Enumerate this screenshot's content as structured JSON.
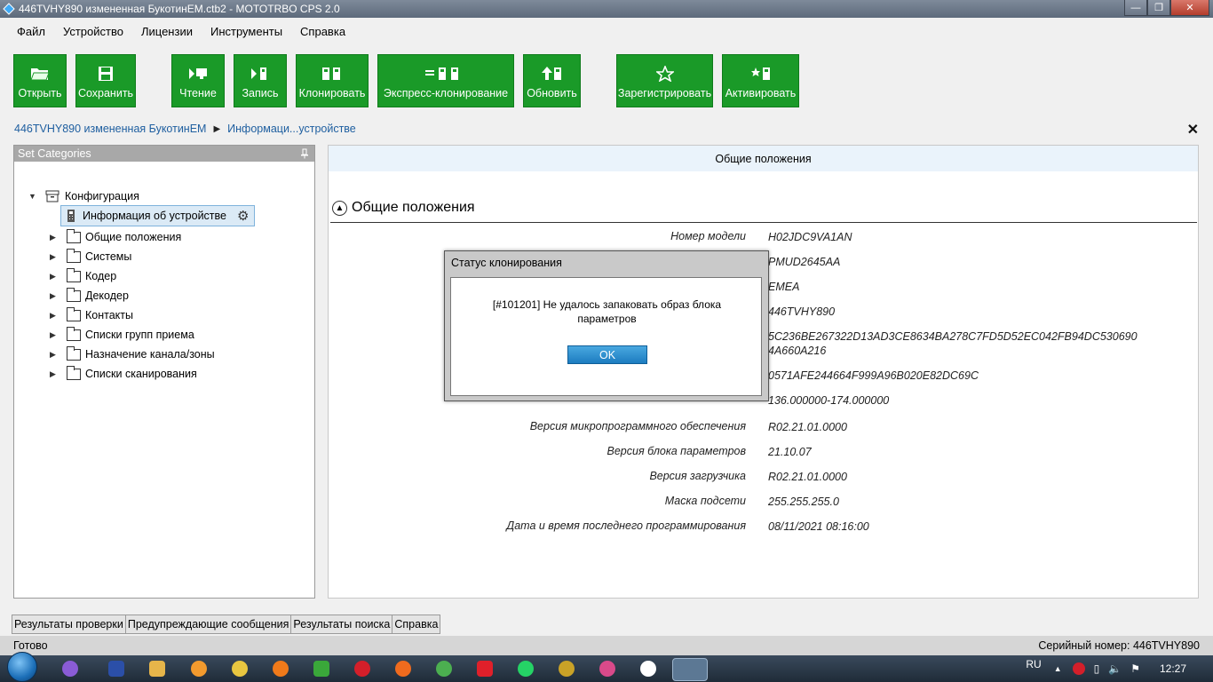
{
  "window": {
    "title": "446TVHY890 измененная БукотинЕМ.ctb2 - MOTOTRBO CPS 2.0",
    "controls": [
      "minimize",
      "maximize",
      "close"
    ]
  },
  "menu": [
    "Файл",
    "Устройство",
    "Лицензии",
    "Инструменты",
    "Справка"
  ],
  "toolbar": {
    "color": "#1a9a28",
    "buttons": [
      {
        "label": "Открыть",
        "icon": "folder-open-icon"
      },
      {
        "label": "Сохранить",
        "icon": "save-icon"
      },
      {
        "label": "Чтение",
        "icon": "read-icon"
      },
      {
        "label": "Запись",
        "icon": "write-icon"
      },
      {
        "label": "Клонировать",
        "icon": "clone-icon"
      },
      {
        "label": "Экспресс-клонирование",
        "icon": "express-clone-icon"
      },
      {
        "label": "Обновить",
        "icon": "update-icon"
      },
      {
        "label": "Зарегистрировать",
        "icon": "star-icon"
      },
      {
        "label": "Активировать",
        "icon": "activate-icon"
      }
    ]
  },
  "breadcrumb": {
    "root": "446TVHY890 измененная БукотинЕМ",
    "current": "Информаци...устройстве"
  },
  "left_panel": {
    "title": "Set Categories",
    "root": "Конфигурация",
    "selected": "Информация об устройстве",
    "items": [
      "Общие положения",
      "Системы",
      "Кодер",
      "Декодер",
      "Контакты",
      "Списки групп приема",
      "Назначение канала/зоны",
      "Списки сканирования"
    ]
  },
  "right_panel": {
    "header": "Общие положения",
    "section": "Общие положения",
    "properties": [
      {
        "label": "Номер модели",
        "value": "H02JDC9VA1AN"
      },
      {
        "label": "",
        "value": "PMUD2645AA"
      },
      {
        "label": "",
        "value": "EMEA"
      },
      {
        "label": "",
        "value": "446TVHY890"
      },
      {
        "label": "",
        "value": "5C236BE267322D13AD3CE8634BA278C7FD5D52EC042FB94DC5306904A660A216"
      },
      {
        "label": "",
        "value": "0571AFE244664F999A96B020E82DC69C"
      },
      {
        "label": "",
        "value": "136.000000-174.000000"
      },
      {
        "label": "Версия микропрограммного обеспечения",
        "value": "R02.21.01.0000"
      },
      {
        "label": "Версия блока параметров",
        "value": "21.10.07"
      },
      {
        "label": "Версия загрузчика",
        "value": "R02.21.01.0000"
      },
      {
        "label": "Маска подсети",
        "value": "255.255.255.0"
      },
      {
        "label": "Дата и время последнего программирования",
        "value": "08/11/2021 08:16:00"
      }
    ]
  },
  "dialog": {
    "title": "Статус клонирования",
    "message": "[#101201] Не удалось запаковать образ блока параметров",
    "ok": "OK"
  },
  "bottom_tabs": [
    "Результаты проверки",
    "Предупреждающие сообщения",
    "Результаты поиска",
    "Справка"
  ],
  "status": {
    "left": "Готово",
    "right": "Серийный номер: 446TVHY890"
  },
  "taskbar": {
    "language": "RU",
    "time": "12:27"
  }
}
